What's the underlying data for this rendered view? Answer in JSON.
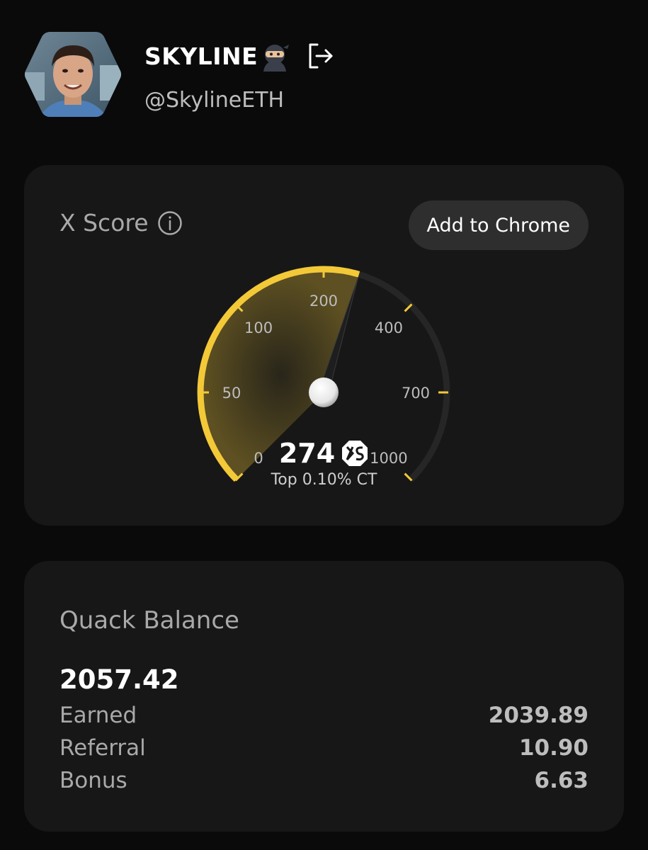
{
  "profile": {
    "username": "SKYLINE",
    "handle": "@SkylineETH",
    "avatar_icon": "avatar-portrait",
    "status_emoji_icon": "ninja-icon",
    "logout_icon": "logout-icon"
  },
  "score_card": {
    "title": "X Score",
    "info_icon": "info-icon",
    "chrome_button_label": "Add to Chrome",
    "score": "274",
    "score_badge_icon": "xs-badge-icon",
    "rank_text": "Top 0.10% CT",
    "gauge": {
      "value": 274,
      "tick_labels": [
        "0",
        "50",
        "100",
        "200",
        "400",
        "700",
        "1000"
      ],
      "accent_color": "#f3c938",
      "track_color": "#262626"
    }
  },
  "balance_card": {
    "title": "Quack Balance",
    "total": "2057.42",
    "rows": [
      {
        "label": "Earned",
        "value": "2039.89"
      },
      {
        "label": "Referral",
        "value": "10.90"
      },
      {
        "label": "Bonus",
        "value": "6.63"
      }
    ]
  }
}
